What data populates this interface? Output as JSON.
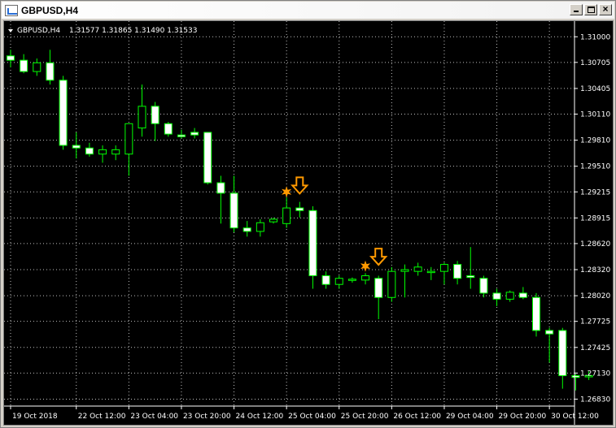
{
  "window": {
    "title": "GBPUSD,H4",
    "buttons": {
      "minimize": "minimize",
      "maximize": "maximize",
      "close": "×"
    }
  },
  "chart_info": {
    "symbol": "GBPUSD,H4",
    "ohlc": "1.31577 1.31865 1.31490 1.31533"
  },
  "colors": {
    "background": "#000000",
    "foreground": "#ffffff",
    "bull_candle": "#000000",
    "bear_candle": "#ffffff",
    "wick": "#00ff00",
    "grid": "#c0c0c0",
    "arrow": "#ff9900",
    "star": "#ff9900"
  },
  "chart_data": {
    "type": "candlestick",
    "symbol": "GBPUSD",
    "timeframe": "H4",
    "y_ticks": [
      "1.31000",
      "1.30705",
      "1.30405",
      "1.30110",
      "1.29810",
      "1.29510",
      "1.29215",
      "1.28915",
      "1.28620",
      "1.28320",
      "1.28020",
      "1.27725",
      "1.27425",
      "1.27130",
      "1.26830"
    ],
    "ylim": [
      1.2675,
      1.3118
    ],
    "x_ticks": [
      {
        "label": "19 Oct 2018",
        "index": 0
      },
      {
        "label": "22 Oct 12:00",
        "index": 5
      },
      {
        "label": "23 Oct 04:00",
        "index": 9
      },
      {
        "label": "23 Oct 20:00",
        "index": 13
      },
      {
        "label": "24 Oct 12:00",
        "index": 17
      },
      {
        "label": "25 Oct 04:00",
        "index": 21
      },
      {
        "label": "25 Oct 20:00",
        "index": 25
      },
      {
        "label": "26 Oct 12:00",
        "index": 29
      },
      {
        "label": "29 Oct 04:00",
        "index": 33
      },
      {
        "label": "29 Oct 20:00",
        "index": 37
      },
      {
        "label": "30 Oct 12:00",
        "index": 41
      }
    ],
    "candles": [
      {
        "o": 1.3078,
        "h": 1.3085,
        "l": 1.3065,
        "c": 1.3073
      },
      {
        "o": 1.3073,
        "h": 1.308,
        "l": 1.3058,
        "c": 1.306
      },
      {
        "o": 1.306,
        "h": 1.3075,
        "l": 1.3055,
        "c": 1.307
      },
      {
        "o": 1.307,
        "h": 1.3085,
        "l": 1.3045,
        "c": 1.305
      },
      {
        "o": 1.305,
        "h": 1.3055,
        "l": 1.297,
        "c": 1.2975
      },
      {
        "o": 1.2975,
        "h": 1.299,
        "l": 1.296,
        "c": 1.2972
      },
      {
        "o": 1.2972,
        "h": 1.2978,
        "l": 1.2962,
        "c": 1.2965
      },
      {
        "o": 1.2965,
        "h": 1.2975,
        "l": 1.2955,
        "c": 1.297
      },
      {
        "o": 1.2965,
        "h": 1.2975,
        "l": 1.2958,
        "c": 1.297
      },
      {
        "o": 1.2965,
        "h": 1.3,
        "l": 1.294,
        "c": 1.3
      },
      {
        "o": 1.2995,
        "h": 1.3045,
        "l": 1.2985,
        "c": 1.302
      },
      {
        "o": 1.302,
        "h": 1.3025,
        "l": 1.298,
        "c": 1.3
      },
      {
        "o": 1.3,
        "h": 1.3002,
        "l": 1.2985,
        "c": 1.2988
      },
      {
        "o": 1.2987,
        "h": 1.2993,
        "l": 1.2983,
        "c": 1.2985
      },
      {
        "o": 1.299,
        "h": 1.2995,
        "l": 1.2983,
        "c": 1.2987
      },
      {
        "o": 1.299,
        "h": 1.299,
        "l": 1.293,
        "c": 1.2932
      },
      {
        "o": 1.2932,
        "h": 1.294,
        "l": 1.2885,
        "c": 1.292
      },
      {
        "o": 1.292,
        "h": 1.294,
        "l": 1.2875,
        "c": 1.288
      },
      {
        "o": 1.288,
        "h": 1.2888,
        "l": 1.287,
        "c": 1.2876
      },
      {
        "o": 1.2876,
        "h": 1.289,
        "l": 1.287,
        "c": 1.2886
      },
      {
        "o": 1.2887,
        "h": 1.2892,
        "l": 1.2885,
        "c": 1.289
      },
      {
        "o": 1.2885,
        "h": 1.2915,
        "l": 1.288,
        "c": 1.2903
      },
      {
        "o": 1.2903,
        "h": 1.291,
        "l": 1.2892,
        "c": 1.29
      },
      {
        "o": 1.29,
        "h": 1.2905,
        "l": 1.281,
        "c": 1.2825
      },
      {
        "o": 1.2825,
        "h": 1.283,
        "l": 1.281,
        "c": 1.2815
      },
      {
        "o": 1.2815,
        "h": 1.2825,
        "l": 1.281,
        "c": 1.2822
      },
      {
        "o": 1.282,
        "h": 1.2823,
        "l": 1.2817,
        "c": 1.2821
      },
      {
        "o": 1.282,
        "h": 1.2828,
        "l": 1.2815,
        "c": 1.2825
      },
      {
        "o": 1.2822,
        "h": 1.2825,
        "l": 1.2775,
        "c": 1.28
      },
      {
        "o": 1.28,
        "h": 1.2835,
        "l": 1.2795,
        "c": 1.283
      },
      {
        "o": 1.283,
        "h": 1.2838,
        "l": 1.28,
        "c": 1.2832
      },
      {
        "o": 1.283,
        "h": 1.284,
        "l": 1.2825,
        "c": 1.2835
      },
      {
        "o": 1.283,
        "h": 1.2835,
        "l": 1.282,
        "c": 1.283
      },
      {
        "o": 1.283,
        "h": 1.284,
        "l": 1.2815,
        "c": 1.2838
      },
      {
        "o": 1.2838,
        "h": 1.2842,
        "l": 1.2815,
        "c": 1.2822
      },
      {
        "o": 1.2825,
        "h": 1.2858,
        "l": 1.281,
        "c": 1.2823
      },
      {
        "o": 1.2822,
        "h": 1.2825,
        "l": 1.28,
        "c": 1.2805
      },
      {
        "o": 1.2805,
        "h": 1.281,
        "l": 1.279,
        "c": 1.2798
      },
      {
        "o": 1.2798,
        "h": 1.2808,
        "l": 1.2795,
        "c": 1.2806
      },
      {
        "o": 1.2805,
        "h": 1.2812,
        "l": 1.2798,
        "c": 1.28
      },
      {
        "o": 1.28,
        "h": 1.2805,
        "l": 1.2755,
        "c": 1.2762
      },
      {
        "o": 1.2762,
        "h": 1.2765,
        "l": 1.2725,
        "c": 1.2758
      },
      {
        "o": 1.2762,
        "h": 1.2765,
        "l": 1.2695,
        "c": 1.271
      },
      {
        "o": 1.271,
        "h": 1.2712,
        "l": 1.2693,
        "c": 1.2708
      },
      {
        "o": 1.271,
        "h": 1.2715,
        "l": 1.2705,
        "c": 1.271
      }
    ],
    "signals": [
      {
        "type": "star",
        "index": 21,
        "price": 1.29215
      },
      {
        "type": "down-arrow",
        "index": 22,
        "price": 1.2927
      },
      {
        "type": "star",
        "index": 27,
        "price": 1.2836
      },
      {
        "type": "down-arrow",
        "index": 28,
        "price": 1.2845
      }
    ]
  }
}
